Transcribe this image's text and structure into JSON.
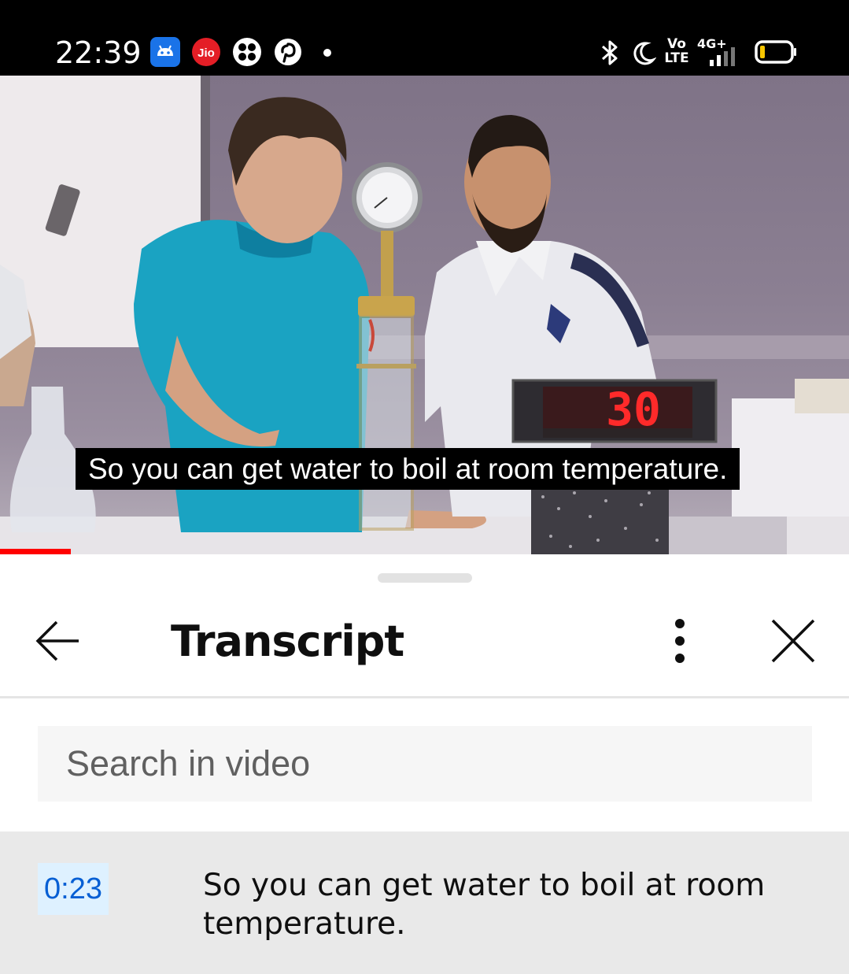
{
  "status_bar": {
    "time": "22:39",
    "notification_icons": [
      "android-app-icon",
      "jio-icon",
      "fan-app-icon",
      "pinterest-icon",
      "dot-icon"
    ],
    "system_icons": [
      "bluetooth-icon",
      "do-not-disturb-moon-icon",
      "volte-icon",
      "4g-signal-icon",
      "battery-icon"
    ],
    "volte_label_top": "Vo",
    "volte_label_bottom": "LTE",
    "network_label": "4G+",
    "jio_label": "Jio"
  },
  "video": {
    "caption": "So you can get water to boil at room temperature.",
    "timer_display": "30",
    "progress_fraction": 0.083,
    "progress_color": "#ff0000"
  },
  "transcript_panel": {
    "title": "Transcript",
    "back_icon": "arrow-left-icon",
    "more_icon": "more-vertical-icon",
    "close_icon": "close-icon",
    "search_placeholder": "Search in video",
    "segments": [
      {
        "timestamp": "0:23",
        "text": "So you can get water to boil at room temperature."
      }
    ]
  },
  "colors": {
    "timestamp_text": "#065fd4",
    "timestamp_bg": "#def1ff",
    "active_row_bg": "#e9e9e9"
  }
}
